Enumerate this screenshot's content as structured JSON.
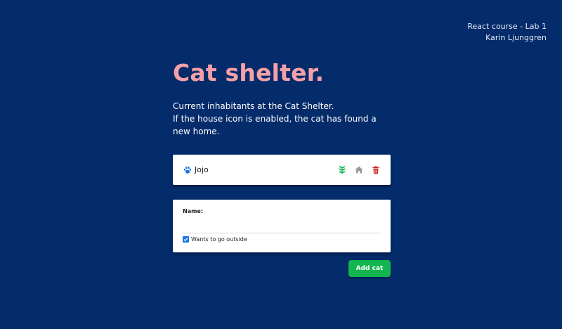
{
  "credits": {
    "course": "React course - Lab 1",
    "author": "Karin Ljunggren"
  },
  "page": {
    "title": "Cat shelter.",
    "intro_line1": "Current inhabitants at the Cat Shelter.",
    "intro_line2": "If the house icon is enabled, the cat has found a new home."
  },
  "cats": [
    {
      "name": "Jojo",
      "icons": [
        "paw-icon",
        "plant-icon",
        "house-icon",
        "trash-icon"
      ],
      "wants_outside": true,
      "found_home": false
    }
  ],
  "form": {
    "name_label": "Name:",
    "name_value": "",
    "outside_label": "Wants to go outside",
    "outside_checked": true,
    "submit_label": "Add cat"
  },
  "colors": {
    "background": "#042b6a",
    "title": "#f4a0a8",
    "paw": "#1a73e8",
    "plant": "#13b550",
    "house_disabled": "#9a9a9a",
    "trash": "#d42020",
    "button": "#13b550",
    "checkbox": "#1a73e8"
  }
}
